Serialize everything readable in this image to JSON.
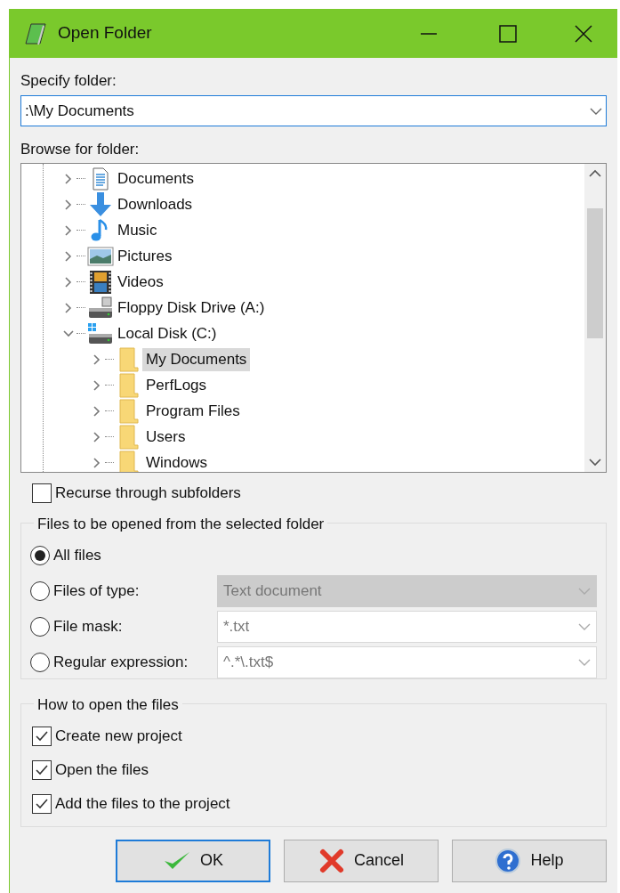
{
  "window": {
    "title": "Open Folder"
  },
  "specify_folder": {
    "label": "Specify folder:",
    "value": ":\\My Documents"
  },
  "browse": {
    "label": "Browse for folder:",
    "tree": [
      {
        "label": "Documents",
        "kind": "documents",
        "expanded": false,
        "selected": false
      },
      {
        "label": "Downloads",
        "kind": "downloads",
        "expanded": false,
        "selected": false
      },
      {
        "label": "Music",
        "kind": "music",
        "expanded": false,
        "selected": false
      },
      {
        "label": "Pictures",
        "kind": "pictures",
        "expanded": false,
        "selected": false
      },
      {
        "label": "Videos",
        "kind": "videos",
        "expanded": false,
        "selected": false
      },
      {
        "label": "Floppy Disk Drive (A:)",
        "kind": "drive",
        "expanded": false,
        "selected": false
      },
      {
        "label": "Local Disk (C:)",
        "kind": "disk",
        "expanded": true,
        "selected": false,
        "children": [
          {
            "label": "My Documents",
            "kind": "folder",
            "expanded": false,
            "selected": true
          },
          {
            "label": "PerfLogs",
            "kind": "folder",
            "expanded": false,
            "selected": false
          },
          {
            "label": "Program Files",
            "kind": "folder",
            "expanded": false,
            "selected": false
          },
          {
            "label": "Users",
            "kind": "folder",
            "expanded": false,
            "selected": false
          },
          {
            "label": "Windows",
            "kind": "folder",
            "expanded": false,
            "selected": false
          }
        ]
      }
    ]
  },
  "recurse": {
    "label": "Recurse through subfolders",
    "checked": false
  },
  "files_group": {
    "title": "Files to be opened from the selected folder",
    "options": [
      {
        "label": "All files",
        "selected": true
      },
      {
        "label": "Files of type:",
        "selected": false,
        "field": {
          "value": "Text document",
          "disabled": true
        }
      },
      {
        "label": "File mask:",
        "selected": false,
        "field": {
          "value": "*.txt",
          "disabled": false
        }
      },
      {
        "label": "Regular expression:",
        "selected": false,
        "field": {
          "value": "^.*\\.txt$",
          "disabled": false
        }
      }
    ]
  },
  "open_group": {
    "title": "How to open the files",
    "options": [
      {
        "label": "Create new project",
        "checked": true
      },
      {
        "label": "Open the files",
        "checked": true
      },
      {
        "label": "Add the files to the project",
        "checked": true
      }
    ]
  },
  "buttons": [
    {
      "label": "OK",
      "kind": "ok",
      "default": true
    },
    {
      "label": "Cancel",
      "kind": "cancel",
      "default": false
    },
    {
      "label": "Help",
      "kind": "help",
      "default": false
    }
  ]
}
